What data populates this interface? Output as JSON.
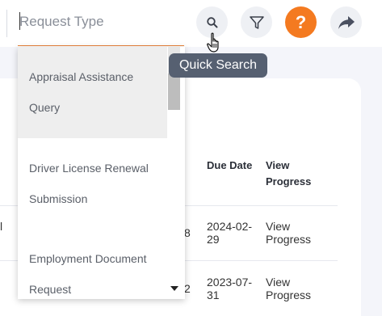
{
  "search": {
    "placeholder": "Request Type",
    "value": ""
  },
  "toolbar": {
    "search_icon": "search-icon",
    "filter_icon": "filter-icon",
    "help_label": "?",
    "share_icon": "share-icon",
    "tooltip": "Quick Search"
  },
  "dropdown": {
    "options": [
      {
        "line1": "Appraisal Assistance",
        "line2": "Query"
      },
      {
        "line1": "Driver License Renewal",
        "line2": "Submission"
      },
      {
        "line1": "Employment Document",
        "line2": "Request"
      }
    ]
  },
  "table": {
    "headers": {
      "due_date": "Due Date",
      "view_progress_1": "View",
      "view_progress_2": "Progress"
    },
    "rows": [
      {
        "left": "l",
        "partial": "8",
        "due_1": "2024-02-",
        "due_2": "29",
        "view_1": "View",
        "view_2": "Progress"
      },
      {
        "partial": "2",
        "due_1": "2023-07-",
        "due_2": "31",
        "view_1": "View",
        "view_2": "Progress"
      }
    ]
  },
  "colors": {
    "accent": "#f47a20",
    "tooltip_bg": "#566071",
    "icon_btn_bg": "#eef0f4"
  }
}
